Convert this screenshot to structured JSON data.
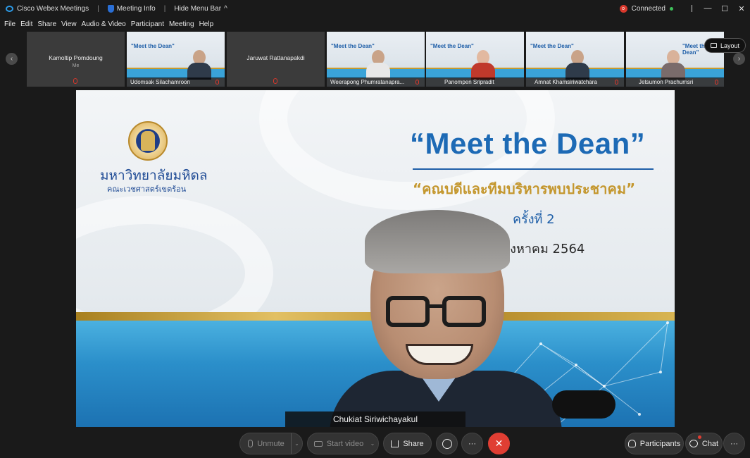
{
  "titlebar": {
    "app_name": "Cisco Webex Meetings",
    "sep": "|",
    "meeting_info": "Meeting Info",
    "hide_menu": "Hide Menu Bar",
    "hide_menu_chevron": "^",
    "status": "Connected",
    "status_color": "#3ec15a",
    "min_glyph": "—",
    "max_glyph": "☐",
    "close_glyph": "✕"
  },
  "menu": [
    "File",
    "Edit",
    "Share",
    "View",
    "Audio & Video",
    "Participant",
    "Meeting",
    "Help"
  ],
  "strip": {
    "prev_glyph": "‹",
    "next_glyph": "›",
    "layout_label": "Layout",
    "participants": [
      {
        "name": "Kamoltip Pomdoung",
        "sub": "Me",
        "video": false
      },
      {
        "name": "Udomsak Silachamroon",
        "video": true
      },
      {
        "name": "Jaruwat Rattanapakdi",
        "video": false
      },
      {
        "name": "Weerapong Phumratanapra...",
        "video": true
      },
      {
        "name": "Panompen Sripradit",
        "video": true
      },
      {
        "name": "Amnat Khamsiriwatchara",
        "video": true
      },
      {
        "name": "Jetsumon Prachumsri",
        "video": true
      }
    ],
    "thumb_title": "\"Meet the Dean\""
  },
  "slide": {
    "university": "มหาวิทยาลัยมหิดล",
    "faculty": "คณะเวชศาสตร์เขตร้อน",
    "title": "“Meet the Dean”",
    "subtitle": "“คณบดีและทีมบริหารพบประชาคม”",
    "round": "ครั้งที่ 2",
    "date": "1 สิงหาคม 2564"
  },
  "speaker_name": "Chukiat Siriwichayakul",
  "controls": {
    "unmute": "Unmute",
    "start_video": "Start video",
    "share": "Share",
    "more": "···",
    "end": "✕",
    "participants": "Participants",
    "chat": "Chat",
    "overflow": "···",
    "caret": "⌄"
  },
  "colors": {
    "end_button": "#e03e33",
    "brand_blue": "#1d6ab5",
    "gold": "#c4972e"
  }
}
